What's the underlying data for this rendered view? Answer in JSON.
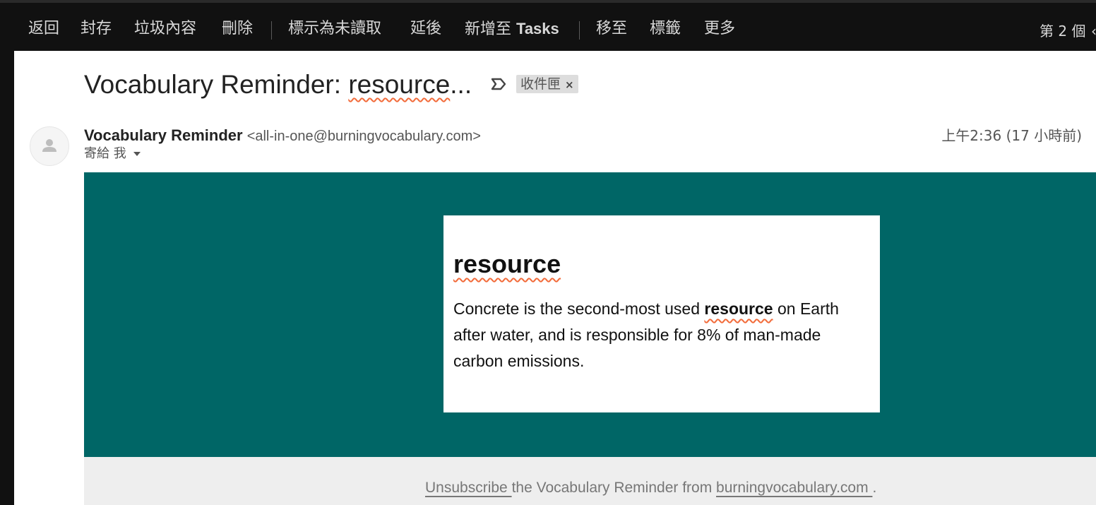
{
  "toolbar": {
    "back": "返回",
    "archive": "封存",
    "spam": "垃圾內容",
    "delete": "刪除",
    "mark_unread": "標示為未讀取",
    "snooze": "延後",
    "add_to_tasks_prefix": "新增至",
    "add_to_tasks_bold": "Tasks",
    "move_to": "移至",
    "labels": "標籤",
    "more": "更多",
    "count": "第 2 個",
    "count_suffix": "‹"
  },
  "email": {
    "subject_prefix": "Vocabulary Reminder: ",
    "subject_word": "resource",
    "subject_ellipsis": "...",
    "label": "收件匣",
    "label_remove": "×",
    "sender_name": "Vocabulary Reminder",
    "sender_email": "<all-in-one@burningvocabulary.com>",
    "to_line": "寄給 我",
    "timestamp": "上午2:36 (17 小時前)"
  },
  "body": {
    "word": "resource",
    "sentence_before": "Concrete is the second-most used ",
    "sentence_bold": "resource",
    "sentence_after": " on Earth after water, and is responsible for 8% of man-made carbon emissions.",
    "banner_color": "#006666"
  },
  "footer": {
    "unsubscribe_link": "Unsubscribe ",
    "middle_text": "the Vocabulary Reminder from ",
    "site_link": "burningvocabulary.com ",
    "end": "."
  },
  "colors": {
    "toolbar_bg": "#111111",
    "spellcheck": "#f26b3a"
  }
}
